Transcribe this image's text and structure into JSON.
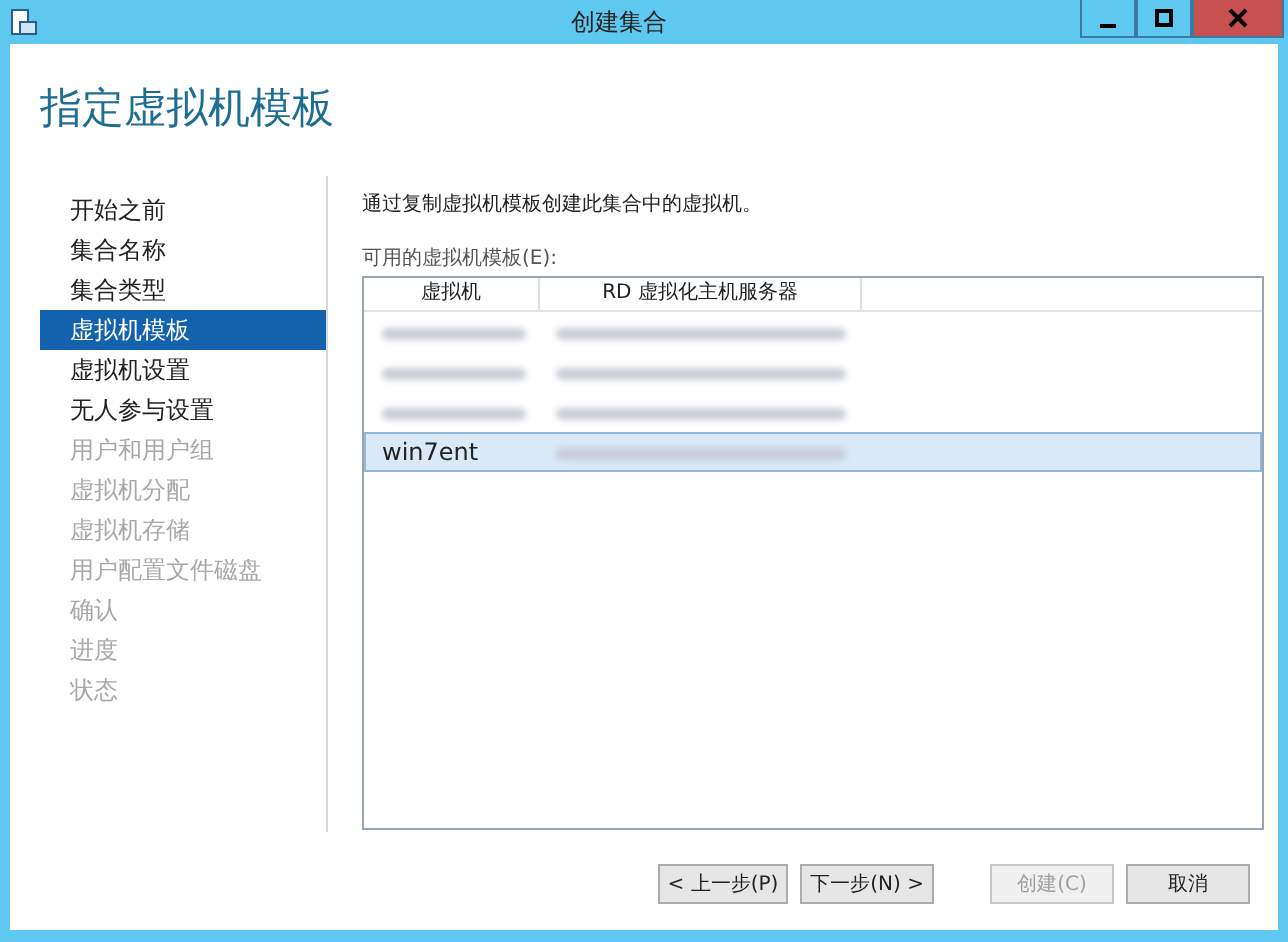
{
  "window": {
    "title": "创建集合"
  },
  "page_title": "指定虚拟机模板",
  "steps": [
    {
      "label": "开始之前",
      "selected": false,
      "disabled": false
    },
    {
      "label": "集合名称",
      "selected": false,
      "disabled": false
    },
    {
      "label": "集合类型",
      "selected": false,
      "disabled": false
    },
    {
      "label": "虚拟机模板",
      "selected": true,
      "disabled": false
    },
    {
      "label": "虚拟机设置",
      "selected": false,
      "disabled": false
    },
    {
      "label": "无人参与设置",
      "selected": false,
      "disabled": false
    },
    {
      "label": "用户和用户组",
      "selected": false,
      "disabled": true
    },
    {
      "label": "虚拟机分配",
      "selected": false,
      "disabled": true
    },
    {
      "label": "虚拟机存储",
      "selected": false,
      "disabled": true
    },
    {
      "label": "用户配置文件磁盘",
      "selected": false,
      "disabled": true
    },
    {
      "label": "确认",
      "selected": false,
      "disabled": true
    },
    {
      "label": "进度",
      "selected": false,
      "disabled": true
    },
    {
      "label": "状态",
      "selected": false,
      "disabled": true
    }
  ],
  "description": "通过复制虚拟机模板创建此集合中的虚拟机。",
  "list_label": "可用的虚拟机模板(E):",
  "table": {
    "columns": [
      "虚拟机",
      "RD 虚拟化主机服务器"
    ],
    "rows": [
      {
        "vm": null,
        "selected": false
      },
      {
        "vm": null,
        "selected": false
      },
      {
        "vm": null,
        "selected": false
      },
      {
        "vm": "win7ent",
        "selected": true
      }
    ]
  },
  "buttons": [
    {
      "label": "< 上一步(P)",
      "disabled": false
    },
    {
      "label": "下一步(N) >",
      "disabled": false
    },
    {
      "label": "创建(C)",
      "disabled": true
    },
    {
      "label": "取消",
      "disabled": false
    }
  ]
}
